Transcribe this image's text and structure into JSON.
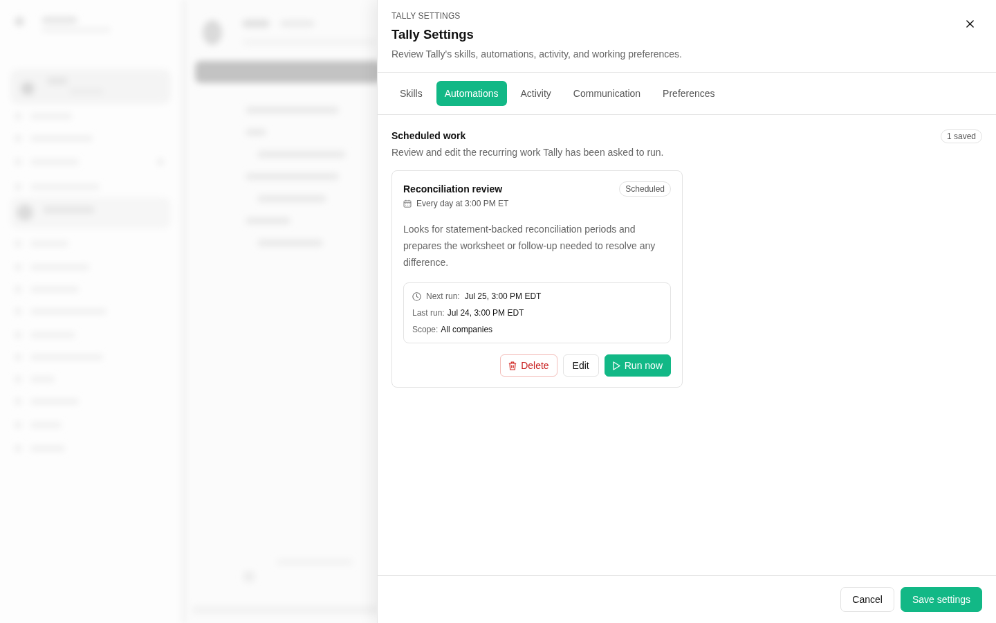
{
  "panel": {
    "eyebrow": "TALLY SETTINGS",
    "title": "Tally Settings",
    "subtitle": "Review Tally's skills, automations, activity, and working preferences."
  },
  "tabs": [
    {
      "label": "Skills",
      "selected": false
    },
    {
      "label": "Automations",
      "selected": true
    },
    {
      "label": "Activity",
      "selected": false
    },
    {
      "label": "Communication",
      "selected": false
    },
    {
      "label": "Preferences",
      "selected": false
    }
  ],
  "section": {
    "title": "Scheduled work",
    "count_badge": "1 saved",
    "description": "Review and edit the recurring work Tally has been asked to run."
  },
  "automations": [
    {
      "title": "Reconciliation review",
      "status": "Scheduled",
      "schedule": "Every day at 3:00 PM ET",
      "description": "Looks for statement-backed reconciliation periods and prepares the worksheet or follow-up needed to resolve any difference.",
      "details": [
        {
          "kind": "next_run",
          "label": "Next run:",
          "value": "Jul 25, 3:00 PM EDT"
        },
        {
          "kind": "last_run",
          "label": "Last run:",
          "value": "Jul 24, 3:00 PM EDT"
        },
        {
          "kind": "scope",
          "label": "Scope:",
          "value": "All companies"
        }
      ],
      "actions": [
        {
          "kind": "delete",
          "label": "Delete"
        },
        {
          "kind": "edit",
          "label": "Edit"
        },
        {
          "kind": "run",
          "label": "Run now"
        }
      ]
    }
  ],
  "footer": {
    "buttons": [
      {
        "kind": "cancel",
        "label": "Cancel"
      },
      {
        "kind": "save",
        "label": "Save settings"
      }
    ]
  }
}
